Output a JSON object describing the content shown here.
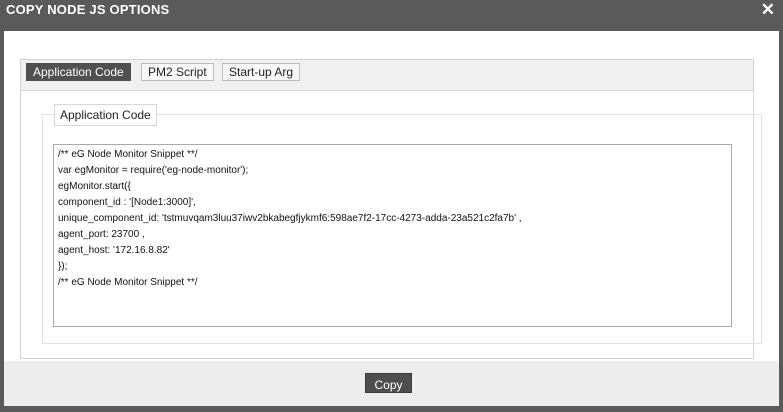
{
  "dialog": {
    "title": "COPY NODE JS OPTIONS",
    "close_glyph": "✕"
  },
  "tabs": [
    {
      "label": "Application Code",
      "active": true
    },
    {
      "label": "PM2 Script",
      "active": false
    },
    {
      "label": "Start-up Arg",
      "active": false
    }
  ],
  "panel": {
    "legend": "Application Code",
    "code_lines": [
      "/** eG Node Monitor Snippet **/",
      "var egMonitor = require('eg-node-monitor');",
      "egMonitor.start({",
      "component_id : '[Node1:3000]',",
      "unique_component_id: 'tstmuvqam3luu37iwv2bkabegfjykmf6:598ae7f2-17cc-4273-adda-23a521c2fa7b' ,",
      "agent_port: 23700 ,",
      "agent_host: '172.16.8.82'",
      "});",
      "/** eG Node Monitor Snippet **/"
    ]
  },
  "footer": {
    "copy_label": "Copy"
  },
  "colors": {
    "titlebar": "#5a5a5a",
    "active_tab": "#505050",
    "button": "#4e4e4e"
  }
}
